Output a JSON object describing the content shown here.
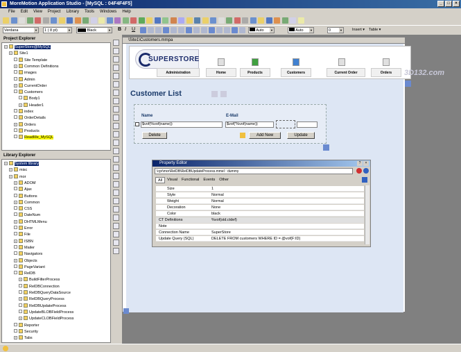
{
  "window": {
    "title": "MoreMotion Application Studio - [MySQL : 04F4F4F5]"
  },
  "menu": [
    "File",
    "Edit",
    "View",
    "Project",
    "Library",
    "Tools",
    "Windows",
    "Help"
  ],
  "format_bar": {
    "font": "Verdana",
    "size": "1 ( 8 pt)",
    "color": "Black",
    "auto1": "Auto",
    "auto2": "Auto",
    "num": "0",
    "insert": "Insert",
    "table": "Table"
  },
  "project_explorer": {
    "title": "Project Explorer",
    "items": [
      {
        "label": "SuperStore@MySQL",
        "d": 0,
        "sel": true
      },
      {
        "label": "Site1",
        "d": 1
      },
      {
        "label": "Site Template",
        "d": 2
      },
      {
        "label": "Common Definitions",
        "d": 2
      },
      {
        "label": "images",
        "d": 2
      },
      {
        "label": "Admin",
        "d": 2
      },
      {
        "label": "CurrentOrder",
        "d": 2
      },
      {
        "label": "Customers",
        "d": 2
      },
      {
        "label": "Body1",
        "d": 3
      },
      {
        "label": "Header1",
        "d": 3
      },
      {
        "label": "index",
        "d": 2
      },
      {
        "label": "OrderDetails",
        "d": 2
      },
      {
        "label": "Orders",
        "d": 2
      },
      {
        "label": "Products",
        "d": 2
      },
      {
        "label": "ReadMe_MySQL",
        "d": 2,
        "hl": true
      }
    ]
  },
  "library_explorer": {
    "title": "Library Explorer",
    "items": [
      {
        "label": "System library",
        "d": 0,
        "sel": true
      },
      {
        "label": "misc",
        "d": 1
      },
      {
        "label": "mor",
        "d": 1
      },
      {
        "label": "ADOM",
        "d": 2
      },
      {
        "label": "Ajax",
        "d": 2
      },
      {
        "label": "Buttons",
        "d": 2
      },
      {
        "label": "Common",
        "d": 2
      },
      {
        "label": "CSS",
        "d": 2
      },
      {
        "label": "DateNum",
        "d": 2
      },
      {
        "label": "DHTMLMenu",
        "d": 2
      },
      {
        "label": "Error",
        "d": 2
      },
      {
        "label": "File",
        "d": 2
      },
      {
        "label": "ISBN",
        "d": 2
      },
      {
        "label": "Mailer",
        "d": 2
      },
      {
        "label": "Navigators",
        "d": 2
      },
      {
        "label": "Objects",
        "d": 2
      },
      {
        "label": "PageVariant",
        "d": 2
      },
      {
        "label": "RelDB",
        "d": 2
      },
      {
        "label": "BuildFilterProcess",
        "d": 3
      },
      {
        "label": "RelDBConnection",
        "d": 3
      },
      {
        "label": "RelDBQueryDataSource",
        "d": 3
      },
      {
        "label": "RelDBQueryProcess",
        "d": 3
      },
      {
        "label": "RelDBUpdateProcess",
        "d": 3
      },
      {
        "label": "UpdateBLOBFieldProcess",
        "d": 3
      },
      {
        "label": "UpdateCLOBFieldProcess",
        "d": 3
      },
      {
        "label": "Reporter",
        "d": 2
      },
      {
        "label": "Security",
        "d": 2
      },
      {
        "label": "Tabs",
        "d": 2
      }
    ]
  },
  "document": {
    "tab": "\\Site1\\Customers.mmpa",
    "logo": "SUPERSTORE",
    "nav": [
      "Administration",
      "Home",
      "Products",
      "Customers",
      "Current Order",
      "Orders"
    ],
    "page_title": "Customer List",
    "col_name": "Name",
    "col_email": "E-Mail",
    "name_value": "$vof(%vof(name))",
    "email_value": "$vof('%vof(name))",
    "delete": "Delete",
    "add_new": "Add New",
    "update": "Update"
  },
  "property_editor": {
    "title": "Property Editor",
    "path": "\\cpr\\mor\\RelDB\\RelDBUpdateProcess.mmel : dummy",
    "tabs": [
      "All",
      "Visual",
      "Functional",
      "Events",
      "Other"
    ],
    "rows": [
      {
        "k": "Size",
        "v": "1",
        "i": 1
      },
      {
        "k": "Style",
        "v": "Normal",
        "i": 1
      },
      {
        "k": "Weight",
        "v": "Normal",
        "i": 1
      },
      {
        "k": "Decoration",
        "v": "None",
        "i": 1
      },
      {
        "k": "Color",
        "v": "black",
        "i": 1
      },
      {
        "k": "CT Definitions",
        "v": "%vof(std.ctdef)",
        "i": 0,
        "g": true
      },
      {
        "k": "Note",
        "v": "",
        "i": 0
      },
      {
        "k": "Connection Name",
        "v": "SuperStore",
        "i": 0
      },
      {
        "k": "Update Query (SQL)",
        "v": "DELETE FROM customers WHERE ID = @vof(F:ID)",
        "i": 0
      }
    ]
  },
  "watermark": "3D132.com"
}
